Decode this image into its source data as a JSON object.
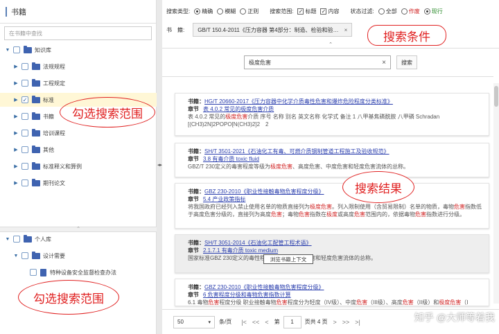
{
  "left": {
    "title": "书籍",
    "search_placeholder": "在书籍中查找",
    "tree1": [
      {
        "label": "知识库",
        "toggle": "▼"
      },
      {
        "label": "法规规程",
        "toggle": "▶"
      },
      {
        "label": "工程规定",
        "toggle": "▶"
      },
      {
        "label": "标准",
        "toggle": "▶"
      },
      {
        "label": "书籍",
        "toggle": "▶"
      },
      {
        "label": "培训课程",
        "toggle": "▶"
      },
      {
        "label": "其他",
        "toggle": "▶"
      },
      {
        "label": "标准释义和算例",
        "toggle": "▶"
      },
      {
        "label": "期刊论文",
        "toggle": "▶"
      }
    ],
    "tree2": [
      {
        "label": "个人库",
        "toggle": "▼"
      },
      {
        "label": "设计需要",
        "toggle": "▼"
      },
      {
        "label": "特种设备安全监督检查办法",
        "toggle": ""
      }
    ],
    "check_mark": "✓"
  },
  "filters": {
    "type_label": "搜索类型:",
    "type_opts": [
      "精确",
      "模糊",
      "正则"
    ],
    "scope_label": "搜索范围:",
    "scope_opts": [
      "标题",
      "内容"
    ],
    "status_label": "状态过滤:",
    "status_opts": [
      "全部",
      "作废",
      "现行"
    ],
    "book_label": "书　籍:",
    "book_value": "GB/T 150.4-2011《压力容器 第4部分：制造、检验和验收》",
    "remove": "×"
  },
  "search": {
    "query": "极度危害",
    "clear": "×",
    "button": "搜索"
  },
  "results": [
    {
      "book": "HG/T 20660-2017《压力容器中化学介质毒性危害和爆炸危险程度分类标准》",
      "chapter": "表 4.0.2 常见的极度危害介质",
      "snippet": [
        {
          "t": "表 4.0.2 常见的",
          "h": false
        },
        {
          "t": "极度危害",
          "h": true
        },
        {
          "t": "介质 序号 名称 别名 英文名称 化学式 备注 1 八甲基焦磷酰胺 八甲磷 Schradan [(CH3)2N]2POPO[N(CH3)2]2　2",
          "h": false
        }
      ]
    },
    {
      "book": "SH/T 3501-2021《石油化工有毒、可燃介质钢制管道工程施工及验收规范》",
      "chapter": "3.8 有毒介质 toxic fluid",
      "snippet": [
        {
          "t": "GBZ/T 230定义的毒害程度等级为",
          "h": false
        },
        {
          "t": "极度危害",
          "h": true
        },
        {
          "t": "、高度危害、中度危害和轻度危害流体的总称。",
          "h": false
        }
      ]
    },
    {
      "book": "GBZ 230-2010《职业性接触毒物危害程度分级》",
      "chapter": "5.4 产业政策指标",
      "snippet": [
        {
          "t": "将我国政府已经列入禁止使用名单的物质直接列为",
          "h": false
        },
        {
          "t": "极度危害",
          "h": true
        },
        {
          "t": "。列入限制使用（含贸易限制）名单的物质，毒物",
          "h": false
        },
        {
          "t": "危害",
          "h": true
        },
        {
          "t": "指数低于高度危害分级的，直接列为高度",
          "h": false
        },
        {
          "t": "危害",
          "h": true
        },
        {
          "t": "；毒物",
          "h": false
        },
        {
          "t": "危害",
          "h": true
        },
        {
          "t": "指数在",
          "h": false
        },
        {
          "t": "极度",
          "h": true
        },
        {
          "t": "或高度",
          "h": false
        },
        {
          "t": "危害",
          "h": true
        },
        {
          "t": "范围内的，依据毒物",
          "h": false
        },
        {
          "t": "危害",
          "h": true
        },
        {
          "t": "指数进行分级。",
          "h": false
        }
      ]
    },
    {
      "book": "SH/T 3051-2014《石油化工配管工程术语》",
      "chapter": "2.1.7.1 有毒介质 toxic medium",
      "snippet": [
        {
          "t": "国家标准GBZ 230定义的毒性程度",
          "h": false
        },
        {
          "t": "…",
          "h": false
        },
        {
          "t": "危害、中度危害和轻度危害流体的总称。",
          "h": false
        }
      ]
    },
    {
      "book": "GBZ 230-2010《职业性接触毒物危害程度分级》",
      "chapter": "6 危害程度分级和毒物危害指数计算",
      "snippet": [
        {
          "t": "6.1 毒物",
          "h": false
        },
        {
          "t": "危害",
          "h": true
        },
        {
          "t": "程度分级 职业接触毒物",
          "h": false
        },
        {
          "t": "危害",
          "h": true
        },
        {
          "t": "程度分为轻度（IV级）、中度",
          "h": false
        },
        {
          "t": "危害",
          "h": true
        },
        {
          "t": "（III级）、高度",
          "h": false
        },
        {
          "t": "危害",
          "h": true
        },
        {
          "t": "（II级）和",
          "h": false
        },
        {
          "t": "极度危害",
          "h": true
        },
        {
          "t": "（I",
          "h": false
        }
      ]
    }
  ],
  "labels": {
    "book": "书籍：",
    "chapter": "章节"
  },
  "tooltip": "浏览书籍上下文",
  "pager": {
    "size": "50",
    "per_page": "条/页",
    "first": "|<",
    "prev2": "<<",
    "prev": "<",
    "page_prefix": "第",
    "page": "1",
    "page_suffix": "页共 4 页",
    "next": ">",
    "next2": ">>",
    "last": ">|"
  },
  "annotations": {
    "scope_top": "勾选搜索范围",
    "scope_bottom": "勾选搜索范围",
    "conditions": "搜索条件",
    "results": "搜索结果"
  },
  "watermark": "知乎 @大师等着我",
  "colors": {
    "accent": "#3f63b0",
    "highlight": "#d02020",
    "link": "#2b3fae",
    "annotation": "#e02020"
  }
}
